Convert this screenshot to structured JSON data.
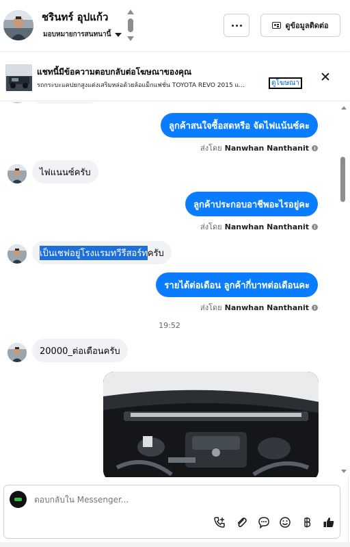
{
  "header": {
    "contact_name": "ชรินทร์ อุปแก้ว",
    "assign_label": "มอบหมายการสนทนานี้",
    "more_label": "···",
    "contact_info_button": "ดูข้อมูลติดต่อ"
  },
  "ad_banner": {
    "title": "แชทนี้มีข้อความตอบกลับต่อโฆษณาของคุณ",
    "subtitle": "รถกระบะแคปยกสูงแต่งเสริมหล่อด้วยล้อแม็กแฟชั่น TOYOTA REVO 2015 แ...",
    "link": "ดูโฆษณา"
  },
  "messages": [
    {
      "dir": "out",
      "text": "ลูกค้าสนใจซื้อสดหรือ จัดไฟแน้นซ์คะ"
    },
    {
      "dir": "in",
      "text": "ไฟแนนซ์ครับ"
    },
    {
      "dir": "out",
      "text": "ลูกค้าประกอบอาชีพอะไรอยู่คะ"
    },
    {
      "dir": "in",
      "text_highlighted": "เป็นเชฟอยู่โรงแรมทวีรีสอร์ท",
      "text_rest": "ครับ"
    },
    {
      "dir": "out",
      "text": "รายได้ต่อเดือน ลูกค้ากี่บาทต่อเดือนคะ"
    },
    {
      "dir": "in",
      "text": "20000_ต่อเดือนครับ"
    }
  ],
  "sent_by": {
    "prefix": "ส่งโดย",
    "name": "Nanwhan Nanthanit"
  },
  "timestamp": "19:52",
  "composer": {
    "placeholder": "ตอบกลับใน Messenger..."
  },
  "icons": {
    "accent": "#0a7cff",
    "tools": [
      "call-add-icon",
      "attachment-icon",
      "quick-reply-icon",
      "emoji-icon",
      "baht-icon",
      "like-icon"
    ]
  }
}
